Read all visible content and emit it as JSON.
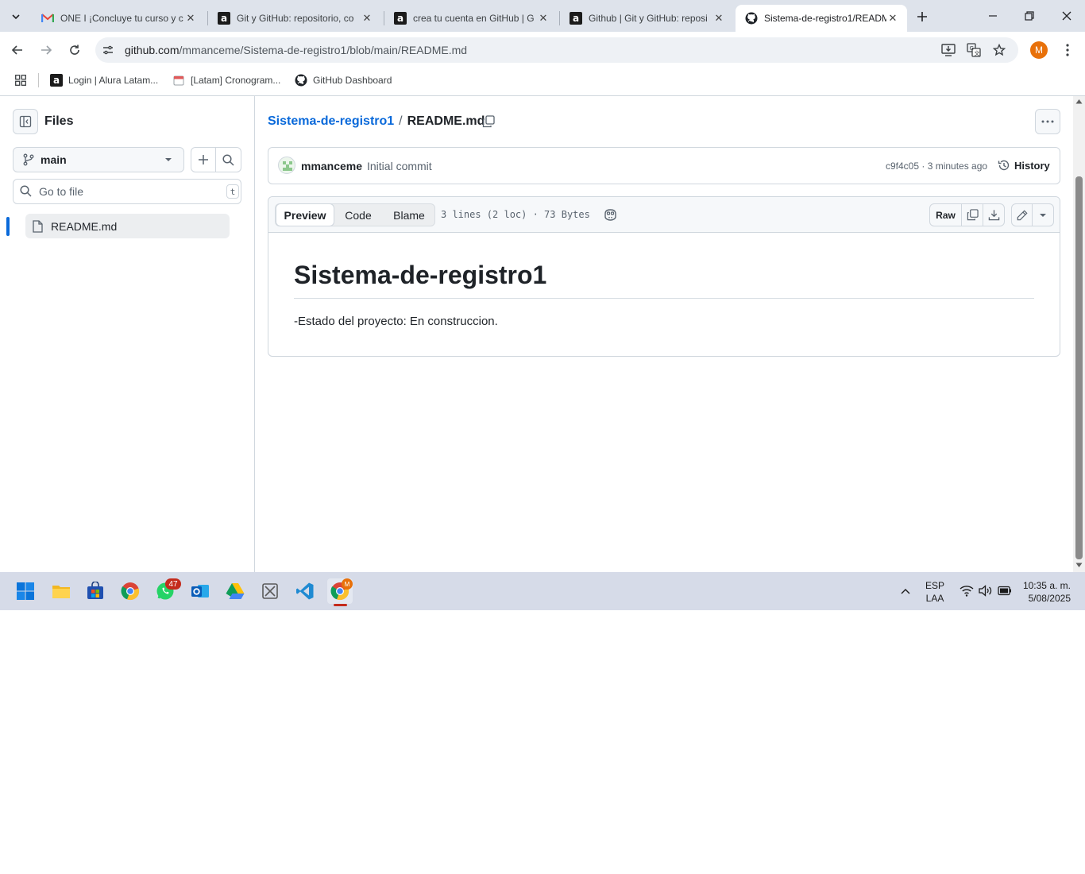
{
  "browser": {
    "tabs": [
      {
        "title": "ONE I ¡Concluye tu curso y c",
        "icon": "gmail-icon"
      },
      {
        "title": "Git y GitHub: repositorio, co",
        "icon": "alura-icon"
      },
      {
        "title": "crea tu cuenta en GitHub | G",
        "icon": "alura-icon"
      },
      {
        "title": "Github | Git y GitHub: reposi",
        "icon": "alura-icon"
      },
      {
        "title": "Sistema-de-registro1/READM",
        "icon": "github-icon"
      }
    ],
    "url_host": "github.com",
    "url_path": "/mmanceme/Sistema-de-registro1/blob/main/README.md",
    "profile_initial": "M",
    "bookmarks": [
      {
        "label": "Login | Alura Latam...",
        "icon": "alura-icon"
      },
      {
        "label": "[Latam] Cronogram...",
        "icon": "calendar-icon"
      },
      {
        "label": "GitHub Dashboard",
        "icon": "github-icon"
      }
    ]
  },
  "sidebar": {
    "title": "Files",
    "branch": "main",
    "search_placeholder": "Go to file",
    "search_shortcut": "t",
    "tree": [
      {
        "label": "README.md",
        "icon": "file-icon"
      }
    ]
  },
  "breadcrumb": {
    "repo": "Sistema-de-registro1",
    "separator": "/",
    "file": "README.md"
  },
  "commit": {
    "author": "mmanceme",
    "message": "Initial commit",
    "sha_time": "c9f4c05 · 3 minutes ago",
    "history_label": "History"
  },
  "file_view": {
    "tabs": [
      "Preview",
      "Code",
      "Blame"
    ],
    "info": "3 lines (2 loc) · 73 Bytes",
    "raw_label": "Raw"
  },
  "readme": {
    "title": "Sistema-de-registro1",
    "body": "-Estado del proyecto: En construccion."
  },
  "taskbar": {
    "whatsapp_badge": "47",
    "chrome_badge": "M",
    "lang_top": "ESP",
    "lang_bottom": "LAA",
    "time": "10:35 a. m.",
    "date": "5/08/2025"
  },
  "colors": {
    "accent": "#0969da",
    "tabstrip": "#dee3eb",
    "taskbar": "#d6dbe8",
    "profile": "#e8710a"
  }
}
